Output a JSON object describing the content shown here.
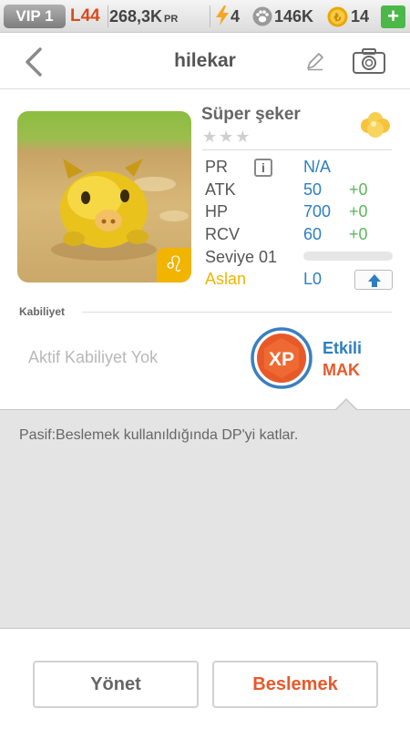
{
  "status_bar": {
    "vip": "VIP 1",
    "level": "L44",
    "pr_value": "268,3K",
    "pr_unit": "PR",
    "energy": "4",
    "paws": "146K",
    "coins": "14",
    "add_label": "+"
  },
  "header": {
    "title": "hilekar",
    "icons": [
      "back-chevron-icon",
      "pencil-icon",
      "camera-icon"
    ]
  },
  "pet": {
    "name": "Süper şeker",
    "stars": "★★★",
    "zodiac": "♌",
    "stats": {
      "pr_label": "PR",
      "pr_value": "N/A",
      "info_icon": "i",
      "atk_label": "ATK",
      "atk_value": "50",
      "atk_bonus": "+0",
      "hp_label": "HP",
      "hp_value": "700",
      "hp_bonus": "+0",
      "rcv_label": "RCV",
      "rcv_value": "60",
      "rcv_bonus": "+0",
      "level_label": "Seviye 01",
      "level_progress": 0,
      "race_label": "Aslan",
      "race_value": "L0"
    }
  },
  "ability": {
    "heading": "Kabiliyet",
    "active": "Aktif Kabiliyet Yok",
    "badge": "XP",
    "effect_label": "Etkili",
    "effect_value": "MAK",
    "passive": "Pasif:Beslemek kullanıldığında DP'yi katlar."
  },
  "buttons": {
    "manage": "Yönet",
    "feed": "Beslemek"
  },
  "colors": {
    "accent_blue": "#2c7fc0",
    "accent_orange": "#e8592a",
    "bonus_green": "#5cb85c",
    "zodiac_gold": "#f1b400"
  }
}
